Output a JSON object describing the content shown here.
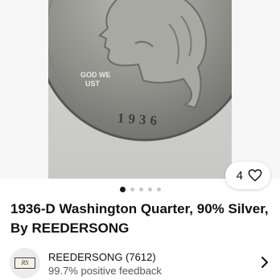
{
  "listing": {
    "image_alt": "1936-D Washington Quarter coin photo",
    "coin_text": {
      "motto_line1": "GOD WE",
      "motto_line2": "UST",
      "year": "1936"
    },
    "like_count": "4",
    "gallery": {
      "total": 5,
      "active_index": 0
    },
    "title": "1936-D Washington Quarter, 90% Silver, By REEDERSONG"
  },
  "seller": {
    "logo_text": "RS",
    "name_rating": "REEDERSONG (7612)",
    "feedback": "99.7% positive feedback"
  },
  "icons": {
    "heart": "heart-icon",
    "chevron": "chevron-right-icon"
  },
  "colors": {
    "text": "#111111",
    "muted": "#555555",
    "dot_active": "#191919",
    "dot_inactive": "#c7c7c7"
  }
}
